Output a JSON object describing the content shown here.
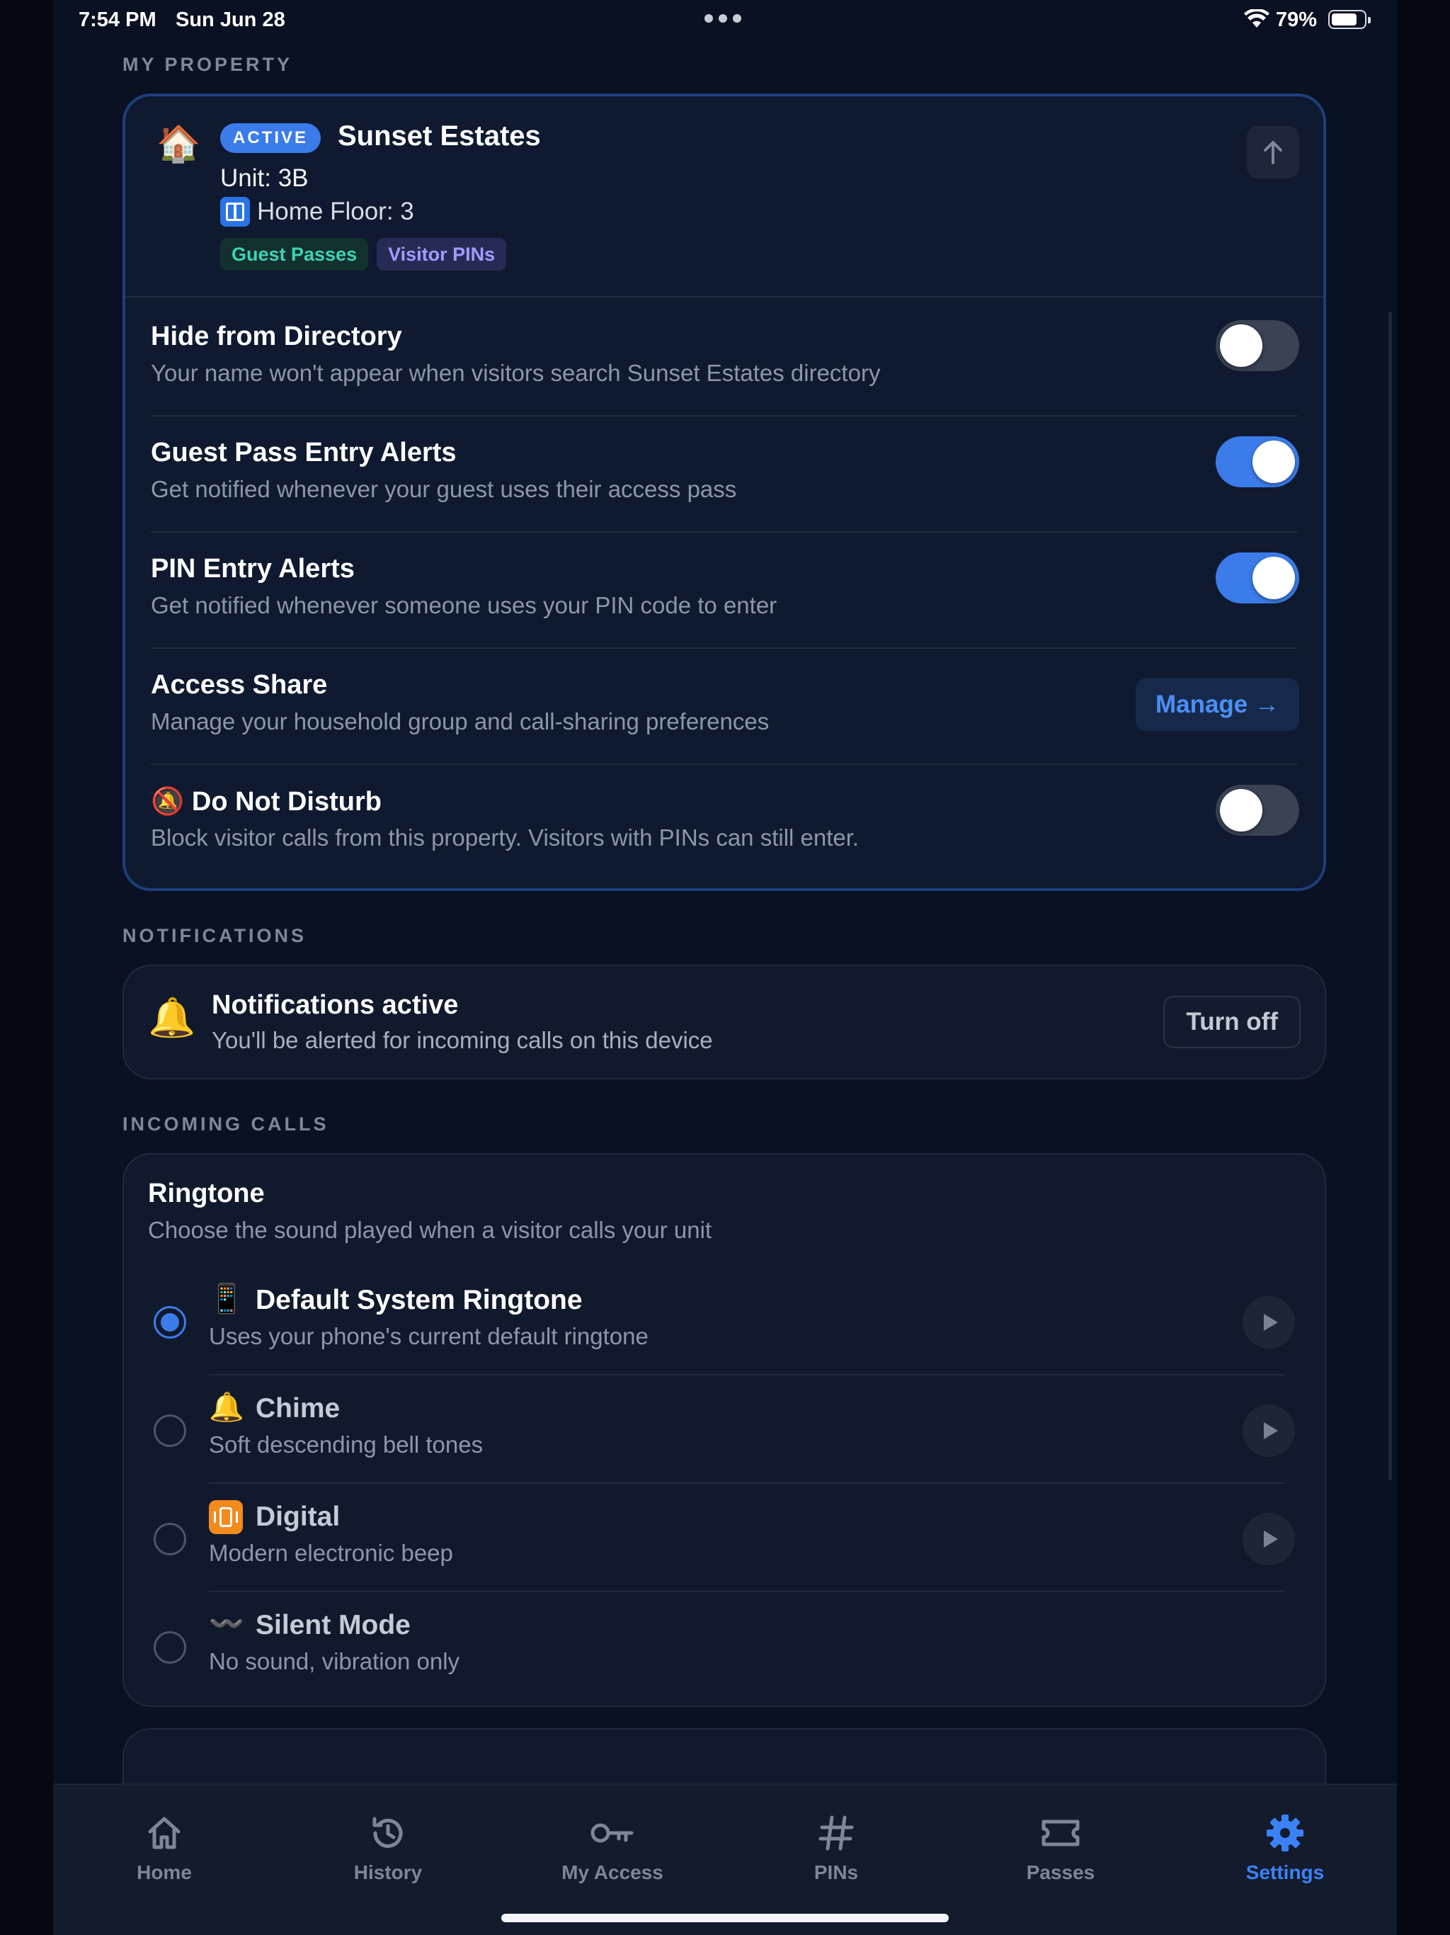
{
  "status_bar": {
    "time": "7:54 PM",
    "date": "Sun Jun 28",
    "battery_percent": "79%",
    "battery_level": 0.79
  },
  "sections": {
    "my_property": "MY PROPERTY",
    "notifications": "NOTIFICATIONS",
    "incoming_calls": "INCOMING CALLS"
  },
  "property": {
    "icon": "house-icon",
    "status_badge": "ACTIVE",
    "name": "Sunset Estates",
    "unit": "Unit: 3B",
    "floor_icon": "elevator-icon",
    "floor": "Home Floor: 3",
    "tags": [
      "Guest Passes",
      "Visitor PINs"
    ]
  },
  "settings": [
    {
      "title": "Hide from Directory",
      "subtitle": "Your name won't appear when visitors search Sunset Estates directory",
      "enabled": false
    },
    {
      "title": "Guest Pass Entry Alerts",
      "subtitle": "Get notified whenever your guest uses their access pass",
      "enabled": true
    },
    {
      "title": "PIN Entry Alerts",
      "subtitle": "Get notified whenever someone uses your PIN code to enter",
      "enabled": true
    },
    {
      "title": "Access Share",
      "subtitle": "Manage your household group and call-sharing preferences",
      "action_label": "Manage →"
    },
    {
      "icon": "🔕",
      "title": "Do Not Disturb",
      "subtitle": "Block visitor calls from this property. Visitors with PINs can still enter.",
      "enabled": false
    }
  ],
  "notifications": {
    "icon": "🔔",
    "title": "Notifications active",
    "subtitle": "You'll be alerted for incoming calls on this device",
    "button_label": "Turn off"
  },
  "ringtone": {
    "title": "Ringtone",
    "subtitle": "Choose the sound played when a visitor calls your unit",
    "options": [
      {
        "icon": "📱",
        "title": "Default System Ringtone",
        "subtitle": "Uses your phone's current default ringtone",
        "selected": true,
        "has_preview": true
      },
      {
        "icon": "🔔",
        "title": "Chime",
        "subtitle": "Soft descending bell tones",
        "selected": false,
        "has_preview": true
      },
      {
        "icon": "digital-icon",
        "title": "Digital",
        "subtitle": "Modern electronic beep",
        "selected": false,
        "has_preview": true
      },
      {
        "icon": "〰️",
        "title": "Silent Mode",
        "subtitle": "No sound, vibration only",
        "selected": false,
        "has_preview": false
      }
    ]
  },
  "tabs": [
    {
      "label": "Home",
      "icon": "home-icon",
      "active": false
    },
    {
      "label": "History",
      "icon": "history-icon",
      "active": false
    },
    {
      "label": "My Access",
      "icon": "key-icon",
      "active": false
    },
    {
      "label": "PINs",
      "icon": "hash-icon",
      "active": false
    },
    {
      "label": "Passes",
      "icon": "ticket-icon",
      "active": false
    },
    {
      "label": "Settings",
      "icon": "gear-icon",
      "active": true
    }
  ],
  "colors": {
    "accent": "#3b7bea",
    "background": "#0a1122",
    "card": "#111a2d",
    "guest_tag": "#3ed3b4",
    "pin_tag": "#a39bff"
  }
}
